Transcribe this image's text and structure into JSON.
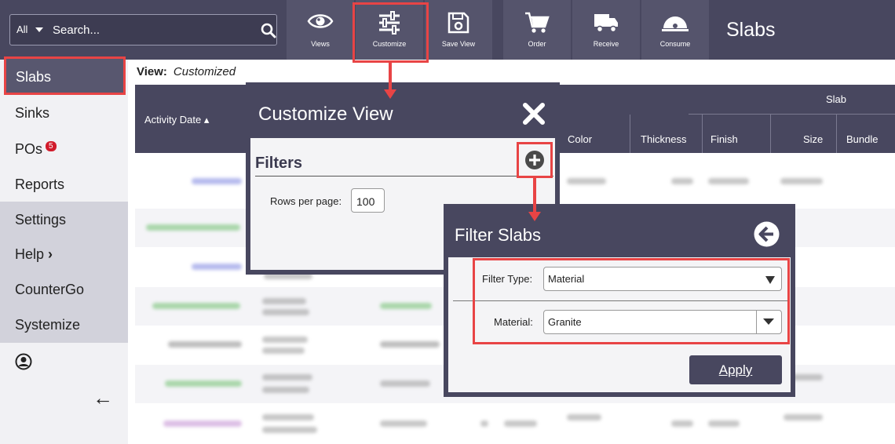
{
  "search": {
    "scope": "All",
    "placeholder": "Search..."
  },
  "toolbar": {
    "views": "Views",
    "customize": "Customize",
    "save_view": "Save View",
    "order": "Order",
    "receive": "Receive",
    "consume": "Consume"
  },
  "page_title": "Slabs",
  "sidebar": {
    "items": [
      {
        "label": "Slabs"
      },
      {
        "label": "Sinks"
      },
      {
        "label": "POs",
        "badge": "5"
      },
      {
        "label": "Reports"
      },
      {
        "label": "Settings"
      },
      {
        "label": "Help"
      },
      {
        "label": "CounterGo"
      },
      {
        "label": "Systemize"
      }
    ],
    "help_chevron": "›",
    "collapse": "←"
  },
  "view": {
    "label": "View:",
    "value": "Customized"
  },
  "table": {
    "group_header": "Slab",
    "columns": [
      "Activity Date ▴",
      "Color",
      "Thickness",
      "Finish",
      "Size",
      "Bundle"
    ]
  },
  "customize_panel": {
    "title": "Customize View",
    "filters_heading": "Filters",
    "rows_label": "Rows per page:",
    "rows_value": "100"
  },
  "filter_panel": {
    "title": "Filter Slabs",
    "filter_type_label": "Filter Type:",
    "filter_type_value": "Material",
    "material_label": "Material:",
    "material_value": "Granite",
    "apply_label": "Apply"
  },
  "colors": {
    "header_bg": "#48475f",
    "button_bg": "#55546c",
    "highlight": "#e84445",
    "badge": "#d11b2b"
  }
}
